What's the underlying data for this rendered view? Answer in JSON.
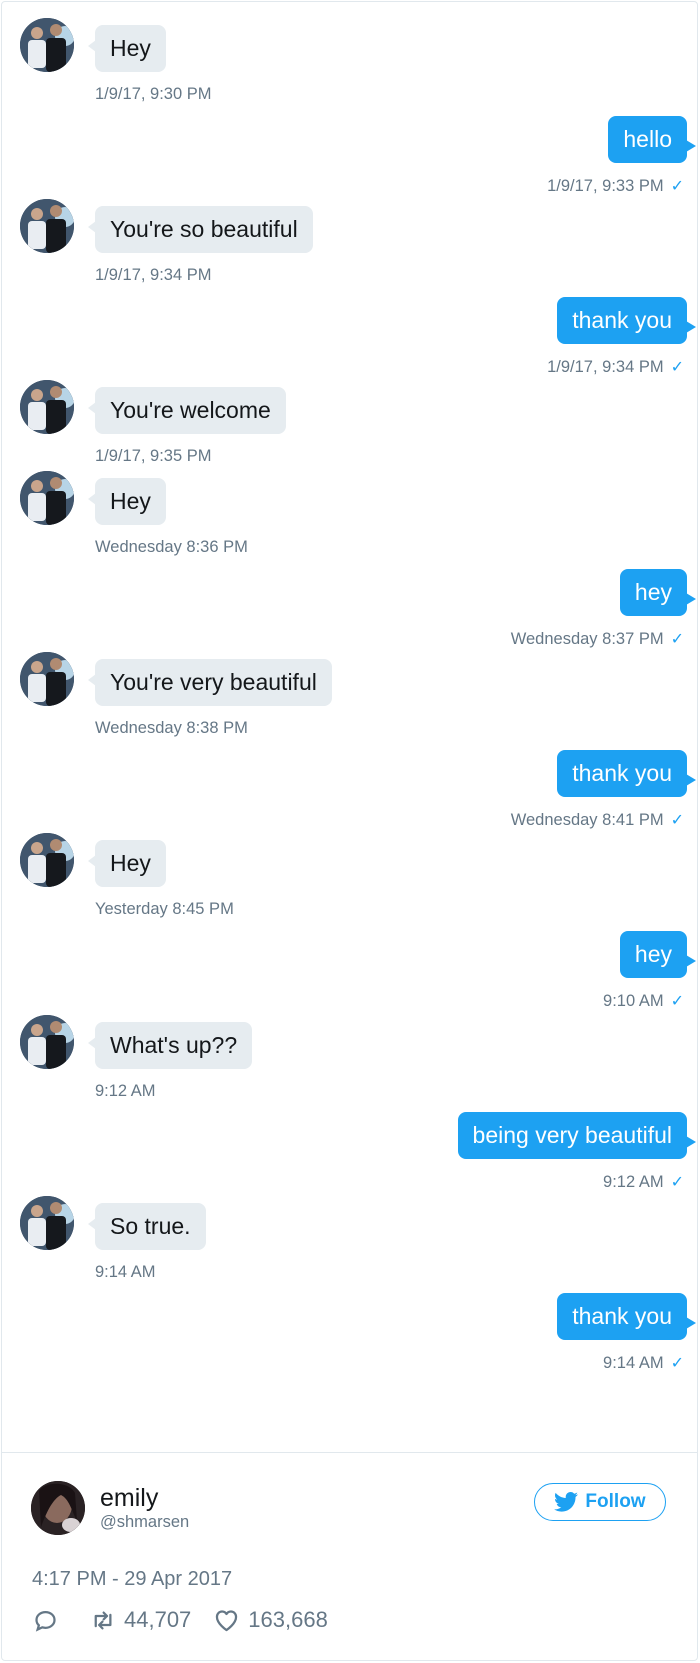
{
  "messages": [
    {
      "dir": "in",
      "text": "Hey",
      "time": "1/9/17, 9:30 PM"
    },
    {
      "dir": "out",
      "text": "hello",
      "time": "1/9/17, 9:33 PM"
    },
    {
      "dir": "in",
      "text": "You're so beautiful",
      "time": "1/9/17, 9:34 PM"
    },
    {
      "dir": "out",
      "text": "thank you",
      "time": "1/9/17, 9:34 PM"
    },
    {
      "dir": "in",
      "text": "You're welcome",
      "time": "1/9/17, 9:35 PM"
    },
    {
      "dir": "in",
      "text": "Hey",
      "time": "Wednesday 8:36 PM"
    },
    {
      "dir": "out",
      "text": "hey",
      "time": "Wednesday 8:37 PM"
    },
    {
      "dir": "in",
      "text": "You're very beautiful",
      "time": "Wednesday 8:38 PM"
    },
    {
      "dir": "out",
      "text": "thank you",
      "time": "Wednesday 8:41 PM"
    },
    {
      "dir": "in",
      "text": "Hey",
      "time": "Yesterday 8:45 PM"
    },
    {
      "dir": "out",
      "text": "hey",
      "time": "9:10 AM"
    },
    {
      "dir": "in",
      "text": "What's up??",
      "time": "9:12 AM"
    },
    {
      "dir": "out",
      "text": "being very beautiful",
      "time": "9:12 AM"
    },
    {
      "dir": "in",
      "text": "So true.",
      "time": "9:14 AM"
    },
    {
      "dir": "out",
      "text": "thank you",
      "time": "9:14 AM"
    }
  ],
  "read_check": "✓",
  "author": {
    "name": "emily",
    "handle": "@shmarsen"
  },
  "follow_label": "Follow",
  "tweet_time": "4:17 PM - 29 Apr 2017",
  "stats": {
    "retweets": "44,707",
    "likes": "163,668"
  },
  "colors": {
    "accent": "#1da1f2",
    "bubble_in": "#e6ecf0",
    "muted": "#657786"
  }
}
